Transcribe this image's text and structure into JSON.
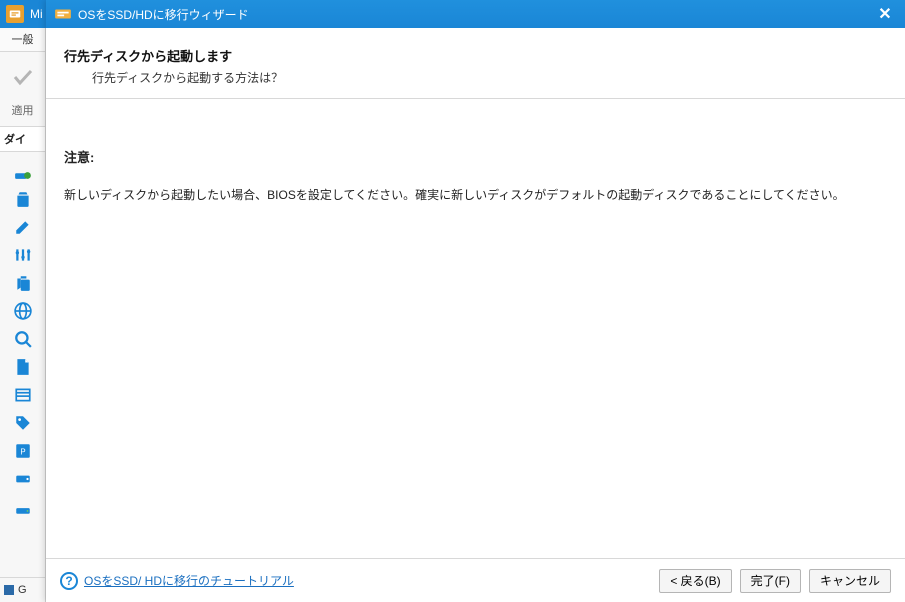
{
  "main_app": {
    "title_prefix": "Mi"
  },
  "sidebar": {
    "tab_general": "一般",
    "apply_label": "適用",
    "section_label": "ダイ",
    "bottom_label": "G",
    "icons": [
      "partition-create-icon",
      "delete-icon",
      "edit-icon",
      "adjust-icon",
      "copy-icon",
      "globe-icon",
      "search-icon",
      "page-icon",
      "list-icon",
      "tag-icon",
      "program-icon",
      "drive-icon",
      "disk-icon"
    ]
  },
  "wizard": {
    "title": "OSをSSD/HDに移行ウィザード",
    "header_title": "行先ディスクから起動します",
    "header_subtitle": "行先ディスクから起動する方法は？",
    "note_label": "注意:",
    "note_body": "新しいディスクから起動したい場合、BIOSを設定してください。確実に新しいディスクがデフォルトの起動ディスクであることにしてください。",
    "tutorial_link": "OSをSSD/ HDに移行のチュートリアル",
    "buttons": {
      "back": "< 戻る(B)",
      "finish": "完了(F)",
      "cancel": "キャンセル"
    }
  }
}
